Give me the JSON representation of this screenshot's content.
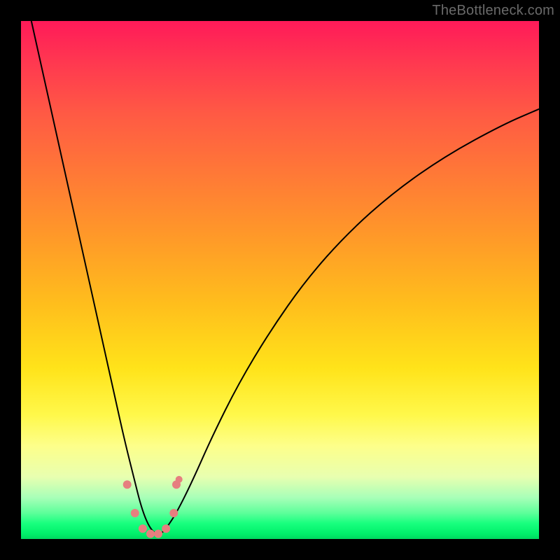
{
  "watermark": "TheBottleneck.com",
  "chart_data": {
    "type": "line",
    "title": "",
    "xlabel": "",
    "ylabel": "",
    "xlim": [
      0,
      100
    ],
    "ylim": [
      0,
      100
    ],
    "grid": false,
    "series": [
      {
        "name": "bottleneck-curve",
        "color": "#000000",
        "x": [
          2,
          4,
          6,
          8,
          10,
          12,
          14,
          16,
          18,
          20,
          22,
          23,
          24,
          25,
          26,
          27,
          28,
          30,
          33,
          37,
          42,
          48,
          55,
          63,
          72,
          82,
          93,
          100
        ],
        "values": [
          100,
          91,
          82,
          73,
          64,
          55,
          46,
          37,
          28,
          19,
          11,
          7,
          4,
          2,
          1,
          1,
          2,
          5,
          11,
          20,
          30,
          40,
          50,
          59,
          67,
          74,
          80,
          83
        ]
      }
    ],
    "markers": [
      {
        "x": 20.5,
        "y": 10.5,
        "r": 6,
        "color": "#e67f7f"
      },
      {
        "x": 22.0,
        "y": 5.0,
        "r": 6,
        "color": "#e67f7f"
      },
      {
        "x": 23.5,
        "y": 2.0,
        "r": 6,
        "color": "#e67f7f"
      },
      {
        "x": 25.0,
        "y": 1.0,
        "r": 6,
        "color": "#e67f7f"
      },
      {
        "x": 26.5,
        "y": 1.0,
        "r": 6,
        "color": "#e67f7f"
      },
      {
        "x": 28.0,
        "y": 2.0,
        "r": 6,
        "color": "#e67f7f"
      },
      {
        "x": 29.5,
        "y": 5.0,
        "r": 6,
        "color": "#e67f7f"
      },
      {
        "x": 30.0,
        "y": 10.5,
        "r": 6,
        "color": "#e67f7f"
      },
      {
        "x": 30.5,
        "y": 11.5,
        "r": 5,
        "color": "#e67f7f"
      }
    ]
  }
}
